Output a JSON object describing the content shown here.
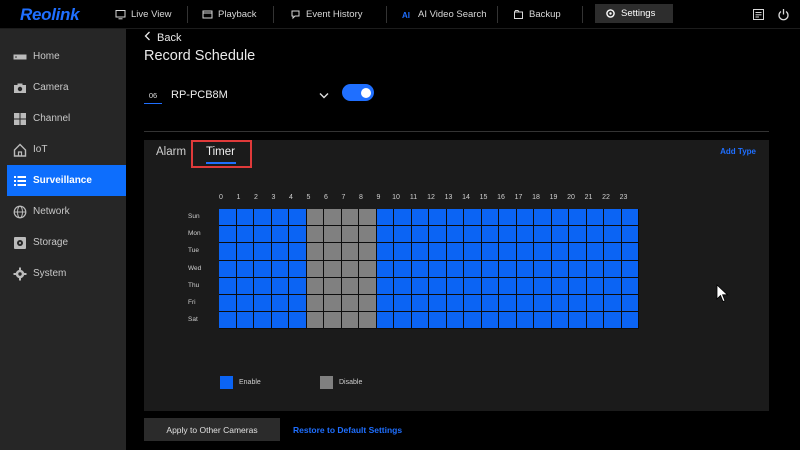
{
  "app": {
    "logo": "Reolink",
    "accent": "#1f6fff"
  },
  "nav": {
    "items": [
      {
        "label": "Live View",
        "icon": "monitor-icon"
      },
      {
        "label": "Playback",
        "icon": "playback-icon"
      },
      {
        "label": "Event History",
        "icon": "event-history-icon"
      },
      {
        "label": "AI Video Search",
        "icon": "ai-search-icon"
      },
      {
        "label": "Backup",
        "icon": "backup-icon"
      },
      {
        "label": "Settings",
        "icon": "gear-icon",
        "active": true
      }
    ]
  },
  "sidebar": {
    "items": [
      {
        "label": "Home",
        "icon": "nvr-icon"
      },
      {
        "label": "Camera",
        "icon": "camera-icon"
      },
      {
        "label": "Channel",
        "icon": "channel-grid-icon"
      },
      {
        "label": "IoT",
        "icon": "iot-home-icon"
      },
      {
        "label": "Surveillance",
        "icon": "surveillance-list-icon",
        "active": true
      },
      {
        "label": "Network",
        "icon": "globe-icon"
      },
      {
        "label": "Storage",
        "icon": "storage-icon"
      },
      {
        "label": "System",
        "icon": "gear-icon"
      }
    ]
  },
  "header": {
    "back_label": "Back",
    "title": "Record Schedule"
  },
  "camera": {
    "number": "06",
    "name": "RP-PCB8M",
    "enabled": true
  },
  "tabs": {
    "alarm": "Alarm",
    "timer": "Timer",
    "add_type": "Add Type"
  },
  "schedule": {
    "hours": [
      "0",
      "1",
      "2",
      "3",
      "4",
      "5",
      "6",
      "7",
      "8",
      "9",
      "10",
      "11",
      "12",
      "13",
      "14",
      "15",
      "16",
      "17",
      "18",
      "19",
      "20",
      "21",
      "22",
      "23"
    ],
    "days": [
      "Sun",
      "Mon",
      "Tue",
      "Wed",
      "Thu",
      "Fri",
      "Sat"
    ],
    "disabled_hours": [
      5,
      6,
      7,
      8
    ],
    "enable_color": "#0b64f4",
    "disable_color": "#808080"
  },
  "legend": {
    "enable": "Enable",
    "disable": "Disable"
  },
  "footer": {
    "apply": "Apply to Other Cameras",
    "restore": "Restore to Default Settings"
  }
}
